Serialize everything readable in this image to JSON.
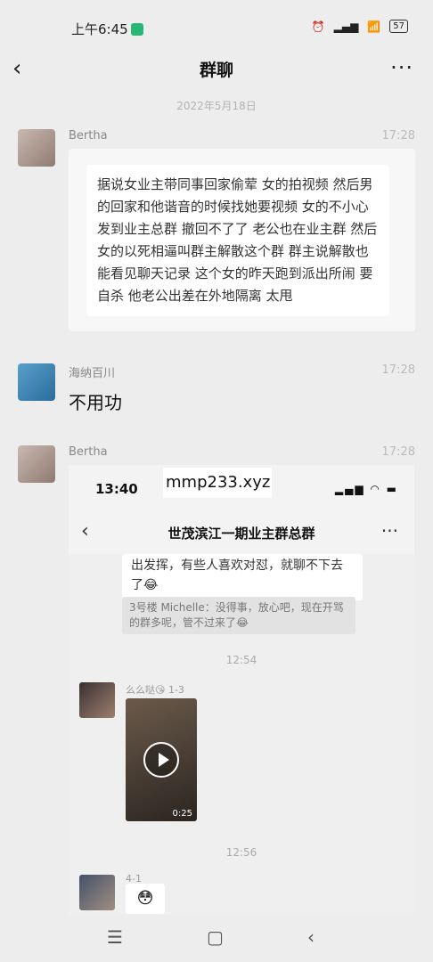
{
  "status_bar": {
    "time": "上午6:45",
    "battery": "57"
  },
  "header": {
    "back": "‹",
    "title": "群聊",
    "more": "···"
  },
  "date_divider": "2022年5月18日",
  "messages": [
    {
      "sender": "Bertha",
      "time": "17:28",
      "avatar": "bertha-avatar",
      "text": "据说女业主带同事回家偷荤 女的拍视频 然后男的回家和他谐音的时候找她要视频 女的不小心发到业主总群 撤回不了了 老公也在业主群 然后女的以死相逼叫群主解散这个群 群主说解散也能看见聊天记录 这个女的昨天跑到派出所闹 要自杀 他老公出差在外地隔离 太甩"
    },
    {
      "sender": "海纳百川",
      "time": "17:28",
      "avatar": "haina-avatar",
      "text": "不用功"
    },
    {
      "sender": "Bertha",
      "time": "17:28",
      "avatar": "bertha-avatar",
      "screenshot": {
        "time": "13:40",
        "title": "世茂滨江一期业主群总群",
        "back": "‹",
        "more": "···",
        "bubble_text": "出发挥，有些人喜欢对怼，就聊不下去了😂",
        "quote_text": "3号楼 Michelle：没得事，放心吧，现在开骂的群多呢，管不过来了😂",
        "stamp1": "12:54",
        "sender1": "么么哒😘 1-3",
        "video_duration": "0:25",
        "stamp2": "12:56",
        "sender2": "4-1",
        "emoji": "😳"
      }
    }
  ],
  "watermark": "mmp233.xyz",
  "nav": {
    "menu": "☰",
    "home": "▢",
    "back": "‹"
  }
}
